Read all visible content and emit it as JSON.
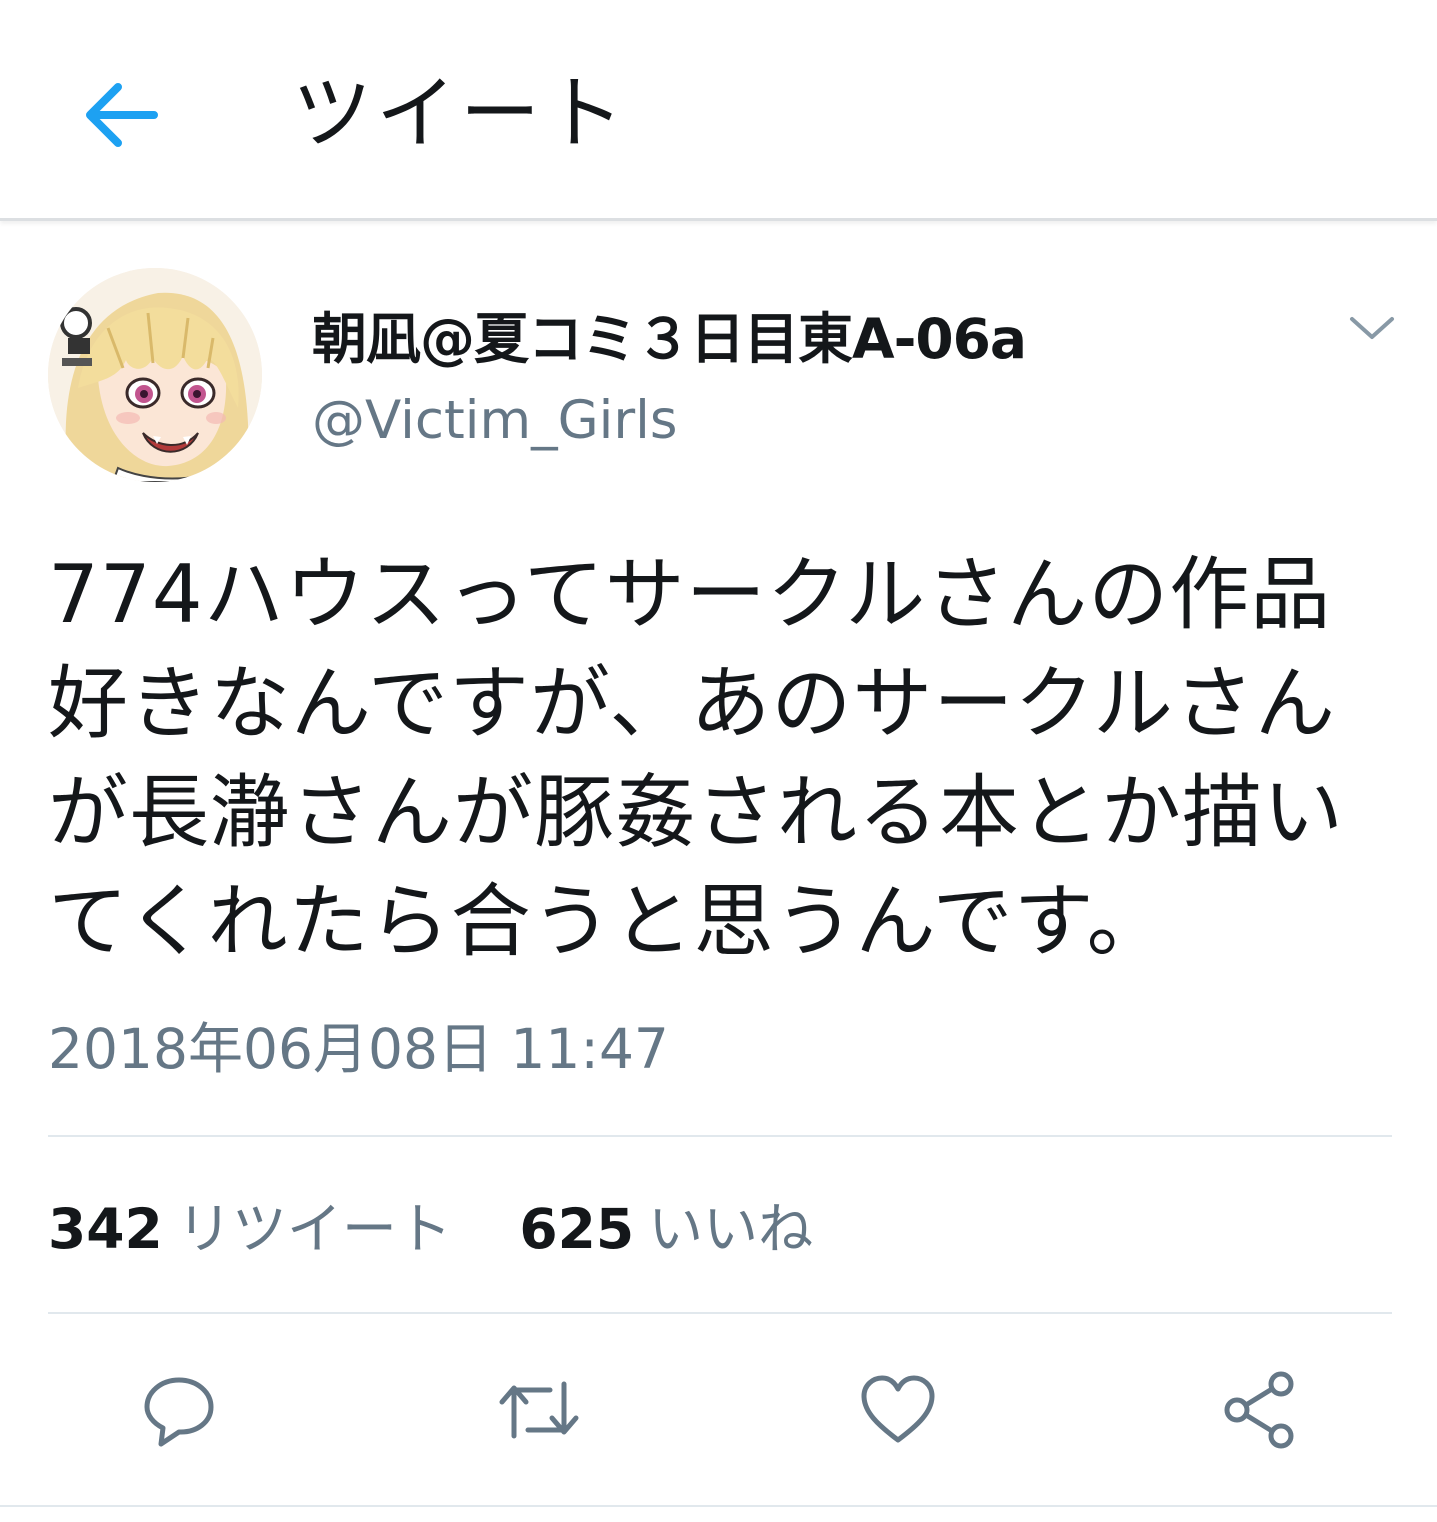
{
  "header": {
    "title": "ツイート",
    "back_icon": "arrow-left-icon",
    "accent_color": "#1da1f2"
  },
  "tweet": {
    "display_name": "朝凪@夏コミ３日目東A-06a",
    "handle": "@Victim_Girls",
    "text_lines": [
      "774ハウスってサークルさんの作品",
      "好きなんですが、あのサークルさん",
      "が長瀞さんが豚姦される本とか描い",
      "てくれたら合うと思うんです。"
    ],
    "timestamp": "2018年06月08日 11:47"
  },
  "stats": {
    "retweets_count": "342",
    "retweets_label": "リツイート",
    "likes_count": "625",
    "likes_label": "いいね"
  },
  "actions": {
    "reply_icon": "reply-icon",
    "retweet_icon": "retweet-icon",
    "like_icon": "heart-icon",
    "share_icon": "share-icon",
    "icon_color": "#657786"
  },
  "colors": {
    "text": "#14171a",
    "secondary": "#657786",
    "divider": "#e1e8ed"
  }
}
